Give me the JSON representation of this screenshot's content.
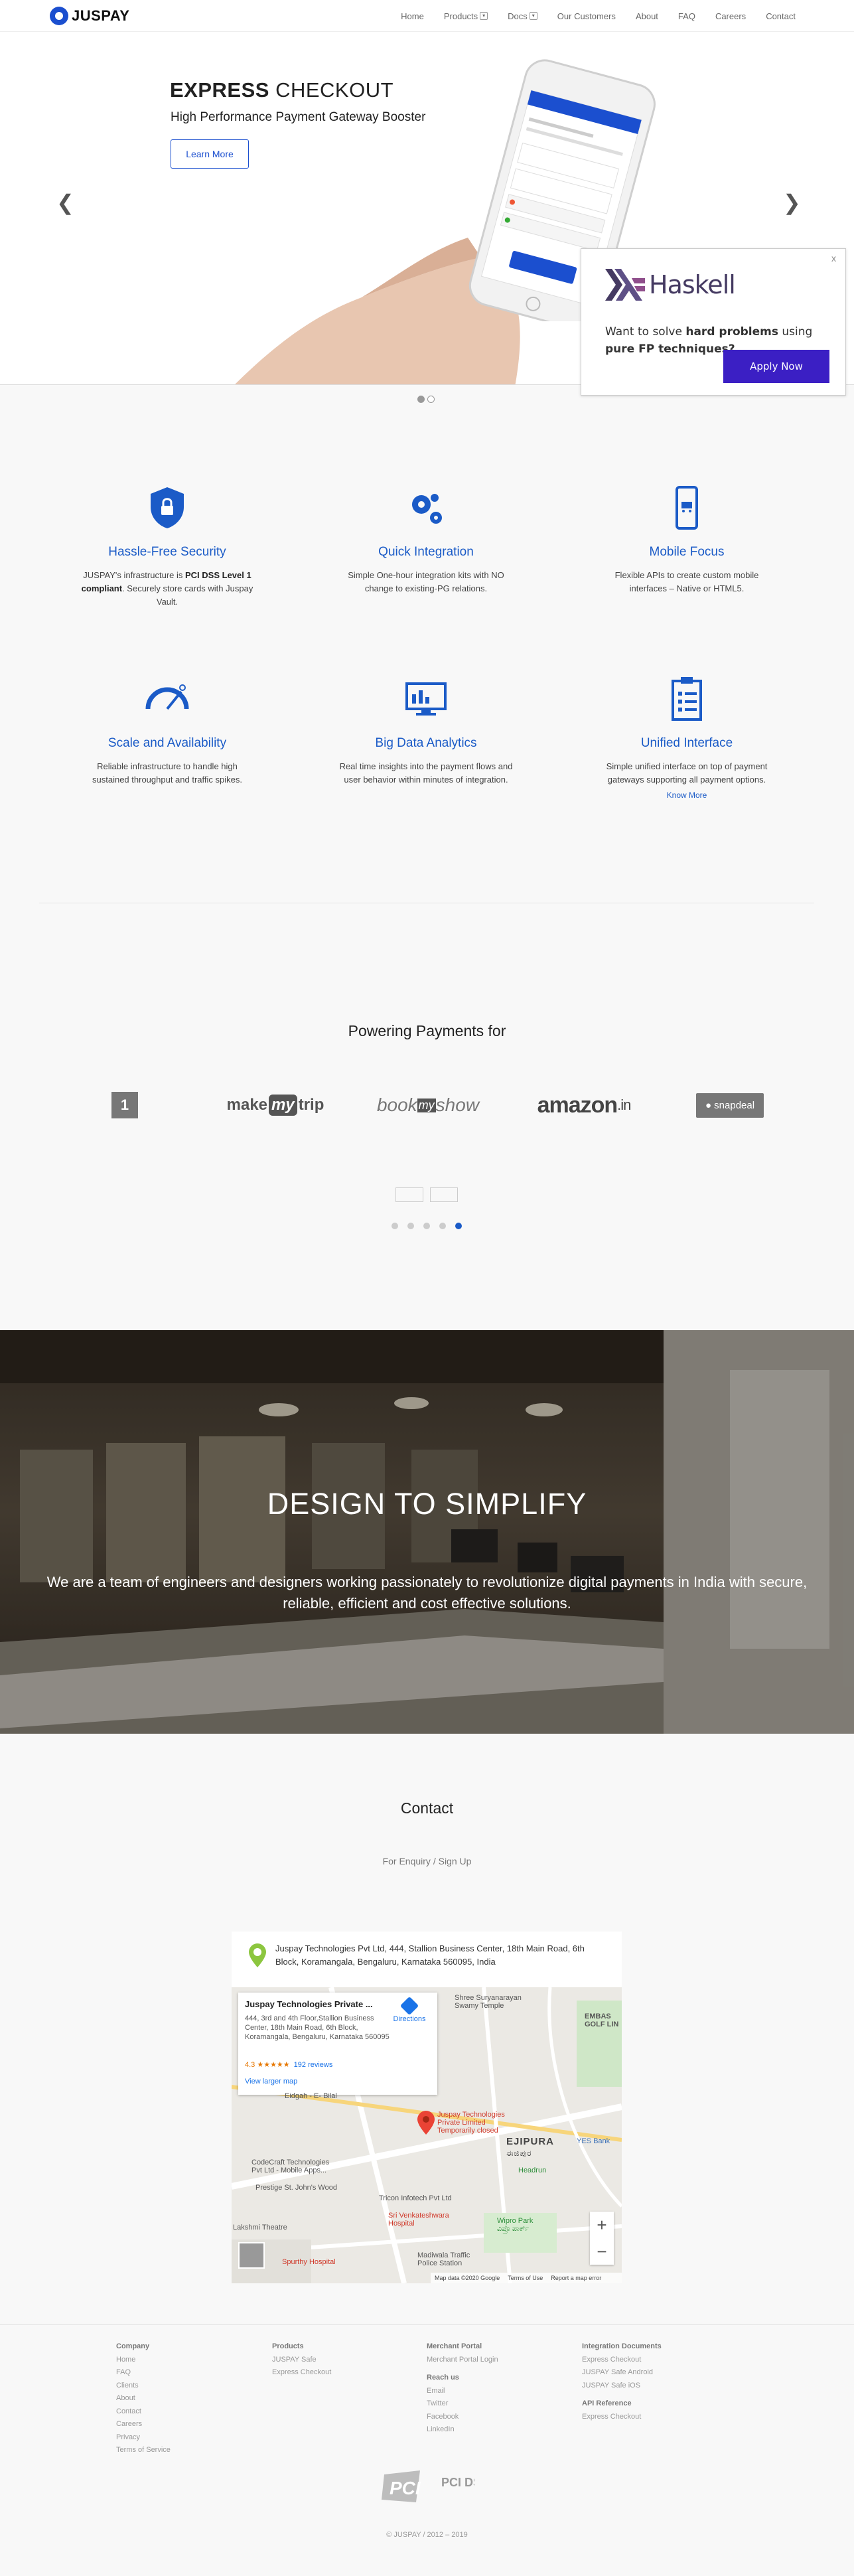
{
  "nav": {
    "brand": "JUSPAY",
    "items": [
      {
        "label": "Home",
        "dropdown": false
      },
      {
        "label": "Products",
        "dropdown": true
      },
      {
        "label": "Docs",
        "dropdown": true
      },
      {
        "label": "Our Customers",
        "dropdown": false
      },
      {
        "label": "About",
        "dropdown": false
      },
      {
        "label": "FAQ",
        "dropdown": false
      },
      {
        "label": "Careers",
        "dropdown": false
      },
      {
        "label": "Contact",
        "dropdown": false
      }
    ]
  },
  "hero": {
    "title_bold": "EXPRESS",
    "title_rest": " CHECKOUT",
    "subtitle": "High Performance Payment Gateway Booster",
    "button": "Learn More",
    "prev_icon": "chevron-left-icon",
    "next_icon": "chevron-right-icon",
    "slides": 2,
    "active_slide": 1
  },
  "ad": {
    "close": "x",
    "brand": "Haskell",
    "text_pre": "Want to solve ",
    "text_bold1": "hard problems",
    "text_mid": " using ",
    "text_bold2": "pure FP techniques?",
    "button": "Apply Now",
    "brand_color": "#453a62",
    "button_color": "#3b1fc4"
  },
  "features": [
    {
      "icon": "shield-lock-icon",
      "title": "Hassle-Free Security",
      "desc_pre": "JUSPAY's infrastructure is ",
      "desc_bold": "PCI DSS Level 1 compliant",
      "desc_post": ". Securely store cards with Juspay Vault.",
      "link": ""
    },
    {
      "icon": "gears-icon",
      "title": "Quick Integration",
      "desc_pre": "Simple One-hour integration kits with NO change to existing-PG relations.",
      "desc_bold": "",
      "desc_post": "",
      "link": ""
    },
    {
      "icon": "mobile-cart-icon",
      "title": "Mobile Focus",
      "desc_pre": "Flexible APIs to create custom mobile interfaces – Native or HTML5.",
      "desc_bold": "",
      "desc_post": "",
      "link": ""
    },
    {
      "icon": "speedometer-icon",
      "title": "Scale and Availability",
      "desc_pre": "Reliable infrastructure to handle high sustained throughput and traffic spikes.",
      "desc_bold": "",
      "desc_post": "",
      "link": ""
    },
    {
      "icon": "analytics-screen-icon",
      "title": "Big Data Analytics",
      "desc_pre": "Real time insights into the payment flows and user behavior within minutes of integration.",
      "desc_bold": "",
      "desc_post": "",
      "link": ""
    },
    {
      "icon": "clipboard-list-icon",
      "title": "Unified Interface",
      "desc_pre": "Simple unified interface on top of payment gateways supporting all payment options.",
      "desc_bold": "",
      "desc_post": "",
      "link": "Know More"
    }
  ],
  "accent_color": "#1b5bc7",
  "powering": {
    "title": "Powering Payments for",
    "brands": [
      "make",
      "my",
      "trip",
      "book",
      "my",
      "show",
      "amazon",
      ".in",
      "snapdeal"
    ],
    "first_brand_glyph": "1",
    "tiny": [
      "",
      ""
    ],
    "pages": 5,
    "active_page": 5
  },
  "team": {
    "title": "DESIGN TO SIMPLIFY",
    "desc": "We are a team of engineers and designers working passionately to revolutionize digital payments in India with secure, reliable, efficient and cost effective solutions."
  },
  "contact": {
    "title": "Contact",
    "subtitle": "For Enquiry / Sign Up",
    "address": "Juspay Technologies Pvt Ltd, 444, Stallion Business Center, 18th Main Road, 6th Block, Koramangala, Bengaluru, Karnataka 560095, India",
    "map": {
      "card_title": "Juspay Technologies Private ...",
      "card_addr": "444, 3rd and 4th Floor,Stallion Business Center, 18th Main Road, 6th Block, Koramangala, Bengaluru, Karnataka 560095",
      "rating": "4.3 ★★★★★",
      "reviews": "192 reviews",
      "larger": "View larger map",
      "directions": "Directions",
      "marker_label_1": "Juspay Technologies",
      "marker_label_2": "Private Limited",
      "marker_label_3": "Temporarily closed",
      "places": {
        "suryanarayan_1": "Shree Suryanarayan",
        "suryanarayan_2": "Swamy Temple",
        "embassy_1": "EMBAS",
        "embassy_2": "GOLF LIN",
        "eidgah": "Eidgah - E- Bilal",
        "ejipura": "EJIPURA",
        "ejipura_kn": "ಈಜಿಪುರ",
        "yes_bank": "YES Bank",
        "codecraft_1": "CodeCraft Technologies",
        "codecraft_2": "Pvt Ltd - Mobile Apps...",
        "headrun": "Headrun",
        "st_johns": "Prestige St. John's Wood",
        "tricon": "Tricon Infotech Pvt Ltd",
        "venkat_1": "Sri Venkateshwara",
        "venkat_2": "Hospital",
        "lakshmi": "Lakshmi Theatre",
        "wipro_1": "Wipro Park",
        "wipro_2": "ವಿಪ್ರೊ ಪಾರ್ಕ್",
        "traffic_1": "Madiwala Traffic",
        "traffic_2": "Police Station",
        "spurthy": "Spurthy Hospital"
      },
      "zoom_in": "+",
      "zoom_out": "−",
      "footer": [
        "Map data ©2020 Google",
        "Terms of Use",
        "Report a map error"
      ]
    }
  },
  "footer": {
    "company": {
      "heading": "Company",
      "links": [
        "Home",
        "FAQ",
        "Clients",
        "About",
        "Contact",
        "Careers",
        "Privacy",
        "Terms of Service"
      ]
    },
    "products": {
      "heading": "Products",
      "links": [
        "JUSPAY Safe",
        "Express Checkout"
      ]
    },
    "merchant": {
      "heading": "Merchant Portal",
      "links": [
        "Merchant Portal Login"
      ],
      "reach_heading": "Reach us",
      "reach_links": [
        "Email",
        "Twitter",
        "Facebook",
        "LinkedIn"
      ]
    },
    "integration": {
      "heading": "Integration Documents",
      "links": [
        "Express Checkout",
        "JUSPAY Safe Android",
        "JUSPAY Safe iOS"
      ],
      "api_heading": "API Reference",
      "api_links": [
        "Express Checkout"
      ]
    },
    "pci_label": "PCI DSS COMPLIANT",
    "copyright": "© JUSPAY / 2012 – 2019"
  }
}
